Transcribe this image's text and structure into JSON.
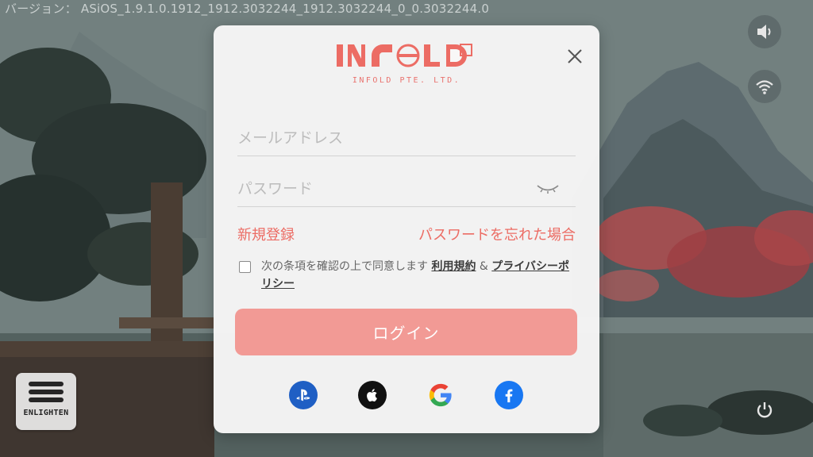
{
  "version_text": "バージョン： ASiOS_1.9.1.0.1912_1912.3032244_1912.3032244_0_0.3032244.0",
  "menu": {
    "label": "ENLIGHTEN"
  },
  "modal": {
    "logo_text": "INFOLD",
    "company": "INFOLD PTE. LTD.",
    "email_placeholder": "メールアドレス",
    "password_placeholder": "パスワード",
    "register_link": "新規登録",
    "forgot_link": "パスワードを忘れた場合",
    "terms": {
      "prefix": "次の条項を確認の上で同意します",
      "terms_link": "利用規約",
      "amp": "&",
      "privacy_link": "プライバシーポリシー"
    },
    "login_button": "ログイン"
  },
  "social": [
    {
      "name": "playstation",
      "color": "#1f5fc4"
    },
    {
      "name": "apple",
      "color": "#111111"
    },
    {
      "name": "google",
      "color": "#ffffff"
    },
    {
      "name": "facebook",
      "color": "#1877f2"
    }
  ],
  "accent_color": "#ec6c64"
}
